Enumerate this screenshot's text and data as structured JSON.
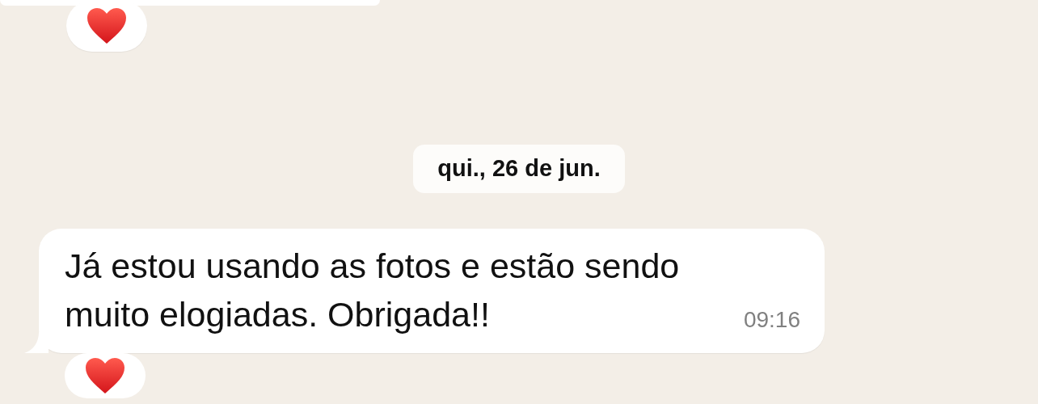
{
  "earlier_message": {
    "reacted": true
  },
  "date_separator": "qui., 26 de jun.",
  "messages": [
    {
      "text": "Já estou usando as fotos e estão sendo muito elogiadas. Obrigada!!",
      "time": "09:16",
      "reacted": true
    }
  ]
}
